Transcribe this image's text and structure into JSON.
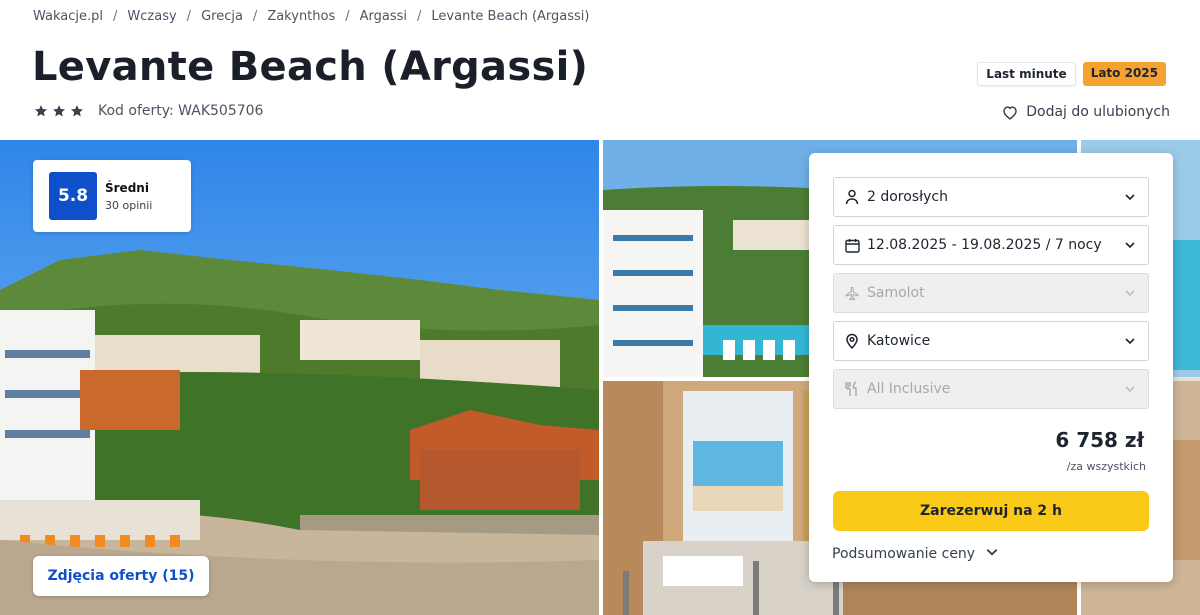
{
  "breadcrumb": [
    "Wakacje.pl",
    "Wczasy",
    "Grecja",
    "Zakynthos",
    "Argassi",
    "Levante Beach (Argassi)"
  ],
  "title": "Levante Beach (Argassi)",
  "stars": 3,
  "offer_code": "Kod oferty: WAK505706",
  "tags": {
    "last_minute": "Last minute",
    "season": "Lato 2025"
  },
  "favorite_label": "Dodaj do ulubionych",
  "rating": {
    "score": "5.8",
    "label": "Średni",
    "count": "30 opinii"
  },
  "photos_button": "Zdjęcia oferty (15)",
  "booking": {
    "travelers": "2 dorosłych",
    "dates": "12.08.2025 - 19.08.2025 / 7 nocy",
    "transport": "Samolot",
    "departure": "Katowice",
    "board": "All Inclusive",
    "price": "6 758 zł",
    "price_note": "/za wszystkich",
    "book_button": "Zarezerwuj na 2 h",
    "summary_label": "Podsumowanie ceny"
  },
  "colors": {
    "primary_blue": "#0f4fc9",
    "cta_yellow": "#fbc918",
    "season_tag": "#f6a230"
  },
  "icons": [
    "star-icon",
    "heart-icon",
    "person-icon",
    "calendar-icon",
    "plane-icon",
    "location-pin-icon",
    "cutlery-icon",
    "chevron-down-icon"
  ]
}
